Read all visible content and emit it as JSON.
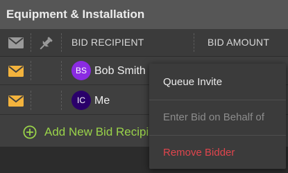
{
  "section": {
    "title": "Equipment & Installation"
  },
  "table": {
    "columns": {
      "bid_recipient": "BID RECIPIENT",
      "bid_amount": "BID AMOUNT"
    },
    "rows": [
      {
        "initials": "BS",
        "name": "Bob Smith",
        "avatar_color": "#8a2be2"
      },
      {
        "initials": "IC",
        "name": "Me",
        "avatar_color": "#2a006a"
      }
    ],
    "add_label": "Add New Bid Recipient"
  },
  "menu": {
    "items": [
      {
        "label": "Queue Invite"
      },
      {
        "label": "Enter Bid on Behalf of"
      },
      {
        "label": "Remove Bidder"
      }
    ]
  },
  "colors": {
    "envelope": "#f3b33d",
    "add_accent": "#9ad34a",
    "danger": "#e0454d",
    "disabled_text": "#8c8c8c"
  },
  "icons": {
    "header_mail": "envelope-icon",
    "header_pin": "pin-icon",
    "row_mail": "envelope-icon",
    "add": "plus-circle-icon"
  }
}
